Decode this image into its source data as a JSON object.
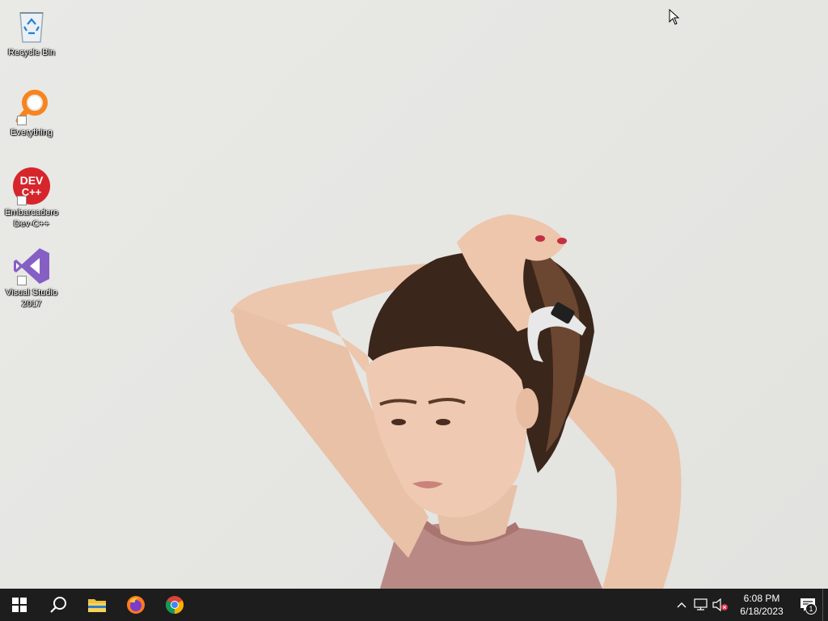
{
  "desktop": {
    "icons": [
      {
        "label": "Recycle Bin",
        "icon": "recycle-bin-icon"
      },
      {
        "label": "Everything",
        "icon": "everything-search-icon"
      },
      {
        "label": "Embarcadero Dev-C++",
        "icon": "devcpp-icon",
        "badge_text": "DEV C++"
      },
      {
        "label": "Visual Studio 2017",
        "icon": "visual-studio-icon"
      }
    ]
  },
  "taskbar": {
    "pinned": [
      {
        "name": "start",
        "icon": "windows-logo-icon"
      },
      {
        "name": "search",
        "icon": "search-icon"
      },
      {
        "name": "file-explorer",
        "icon": "folder-icon"
      },
      {
        "name": "firefox",
        "icon": "firefox-icon"
      },
      {
        "name": "chrome",
        "icon": "chrome-icon"
      }
    ],
    "tray": {
      "icons": [
        "chevron-up-icon",
        "network-icon",
        "volume-muted-icon"
      ],
      "time": "6:08 PM",
      "date": "6/18/2023",
      "notification_count": "1"
    }
  },
  "colors": {
    "taskbar_bg": "#1d1d1d",
    "wallpaper_bg": "#e7e7e4",
    "devcpp_red": "#d6262b",
    "vs_purple": "#865fc5",
    "everything_orange": "#f7841e"
  }
}
